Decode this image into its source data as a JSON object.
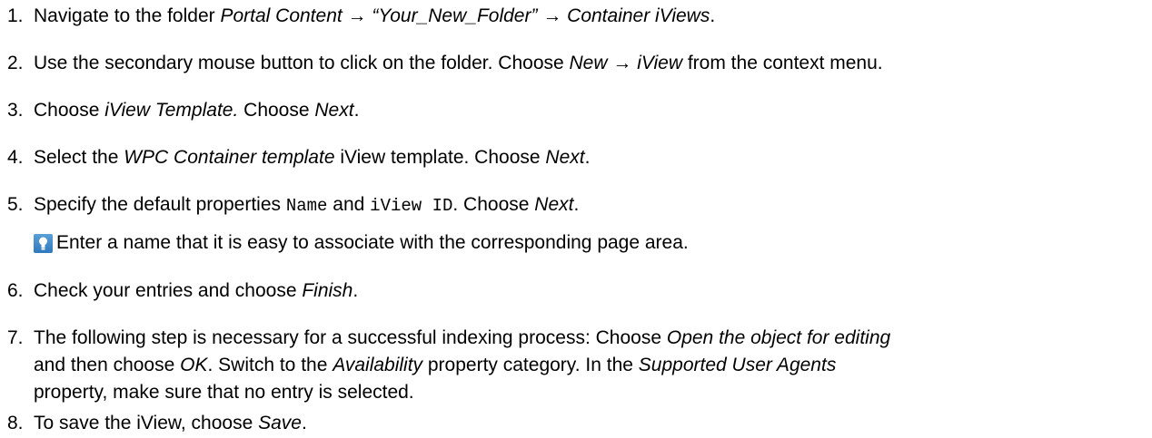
{
  "steps": [
    {
      "num": "1.",
      "parts": [
        "Navigate to the folder ",
        "Portal Content",
        " → ",
        "“Your_New_Folder”",
        " → ",
        "Container iViews",
        "."
      ]
    },
    {
      "num": "2.",
      "parts": [
        "Use the secondary mouse button to click on the folder. Choose ",
        "New",
        " → ",
        "iView",
        " from the context menu."
      ]
    },
    {
      "num": "3.",
      "parts": [
        "Choose ",
        "iView Template.",
        " Choose ",
        "Next",
        "."
      ]
    },
    {
      "num": "4.",
      "parts": [
        "Select the ",
        "WPC Container template",
        " iView template. Choose ",
        "Next",
        "."
      ]
    },
    {
      "num": "5.",
      "parts": [
        "Specify the default properties ",
        "Name",
        " and ",
        "iView ID",
        ". Choose ",
        "Next",
        "."
      ]
    },
    {
      "num": "6.",
      "parts": [
        "Check your entries and choose ",
        "Finish",
        "."
      ]
    },
    {
      "num": "7.",
      "lines": [
        [
          "The following step is necessary for a successful indexing process: Choose ",
          "Open the object for editing"
        ],
        [
          "and then choose ",
          "OK",
          ". Switch to the ",
          "Availability",
          " property category. In the ",
          "Supported User Agents"
        ],
        [
          "property, make sure that no entry is selected."
        ]
      ]
    },
    {
      "num": "8.",
      "parts": [
        "To save the iView, choose ",
        "Save",
        "."
      ]
    }
  ],
  "tip": {
    "icon": "lightbulb-tip-icon",
    "text": "Enter a name that it is easy to associate with the corresponding page area."
  },
  "colors": {
    "tip_icon": "#3a86c8",
    "text": "#000000"
  }
}
